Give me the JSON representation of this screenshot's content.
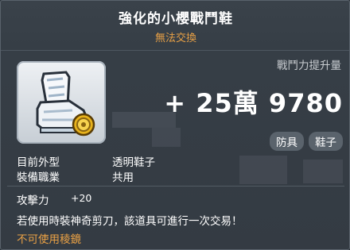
{
  "item": {
    "name": "強化的小櫻戰鬥鞋",
    "trade_status": "無法交換",
    "icon": "boot-icon"
  },
  "combat_power": {
    "label": "戰鬥力提升量",
    "value": "+ 25萬 9780"
  },
  "tags": [
    "防具",
    "鞋子"
  ],
  "info_rows": [
    {
      "label": "目前外型",
      "value": "透明鞋子"
    },
    {
      "label": "裝備職業",
      "value": "共用"
    }
  ],
  "stats": [
    {
      "label": "攻擊力",
      "value": "+20"
    }
  ],
  "description": "若使用時裝神奇剪刀，該道具可進行一次交易！",
  "warning": "不可使用稜鏡",
  "colors": {
    "accent_orange": "#e8a045",
    "background": "#363e46",
    "badge": "#5a636c"
  }
}
